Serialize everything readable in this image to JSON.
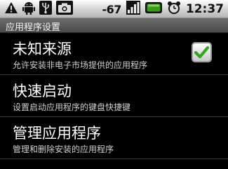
{
  "status_bar": {
    "signal_text": "-67",
    "time": "12:37",
    "icons": [
      "warning-icon",
      "android-icon",
      "usb-icon",
      "camera-icon",
      "signal-bars-icon",
      "battery-icon",
      "alarm-clock-icon"
    ],
    "battery_color": "#3a9a18"
  },
  "title_bar": {
    "title": "应用程序设置"
  },
  "settings": [
    {
      "title": "未知来源",
      "summary": "允许安装非电子市场提供的应用程序",
      "checked": true
    },
    {
      "title": "快速启动",
      "summary": "设置启动应用程序的键盘快捷键"
    },
    {
      "title": "管理应用程序",
      "summary": "管理和删除安装的应用程序"
    }
  ],
  "colors": {
    "check_green": "#2fa81c"
  }
}
